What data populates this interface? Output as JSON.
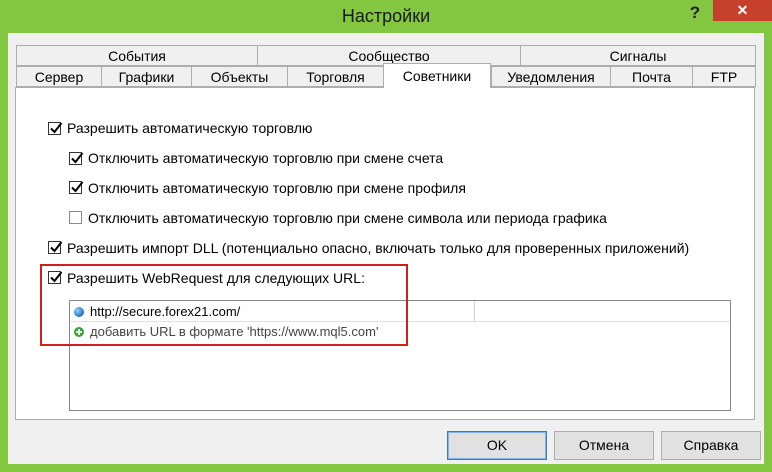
{
  "window": {
    "title": "Настройки",
    "help_label": "?",
    "close_label": "✕",
    "frame_color": "#83c63f"
  },
  "tabs": {
    "row1": [
      "События",
      "Сообщество",
      "Сигналы"
    ],
    "row2": [
      "Сервер",
      "Графики",
      "Объекты",
      "Торговля",
      "Советники",
      "Уведомления",
      "Почта",
      "FTP"
    ],
    "selected": "Советники"
  },
  "options": [
    {
      "label": "Разрешить автоматическую торговлю",
      "checked": true
    },
    {
      "label": "Отключить автоматическую торговлю при смене счета",
      "checked": true
    },
    {
      "label": "Отключить автоматическую торговлю при смене профиля",
      "checked": true
    },
    {
      "label": "Отключить автоматическую торговлю при смене символа или периода графика",
      "checked": false
    },
    {
      "label": "Разрешить импорт DLL (потенциально опасно, включать только для проверенных приложений)",
      "checked": true
    },
    {
      "label": "Разрешить WebRequest для следующих URL:",
      "checked": true
    }
  ],
  "url_list": {
    "items": [
      {
        "text": "http://secure.forex21.com/",
        "icon": "globe-icon"
      },
      {
        "text": "добавить URL в формате 'https://www.mql5.com'",
        "icon": "add-icon"
      }
    ]
  },
  "buttons": {
    "ok": "OK",
    "cancel": "Отмена",
    "help": "Справка"
  },
  "highlight_color": "#d11f1f"
}
